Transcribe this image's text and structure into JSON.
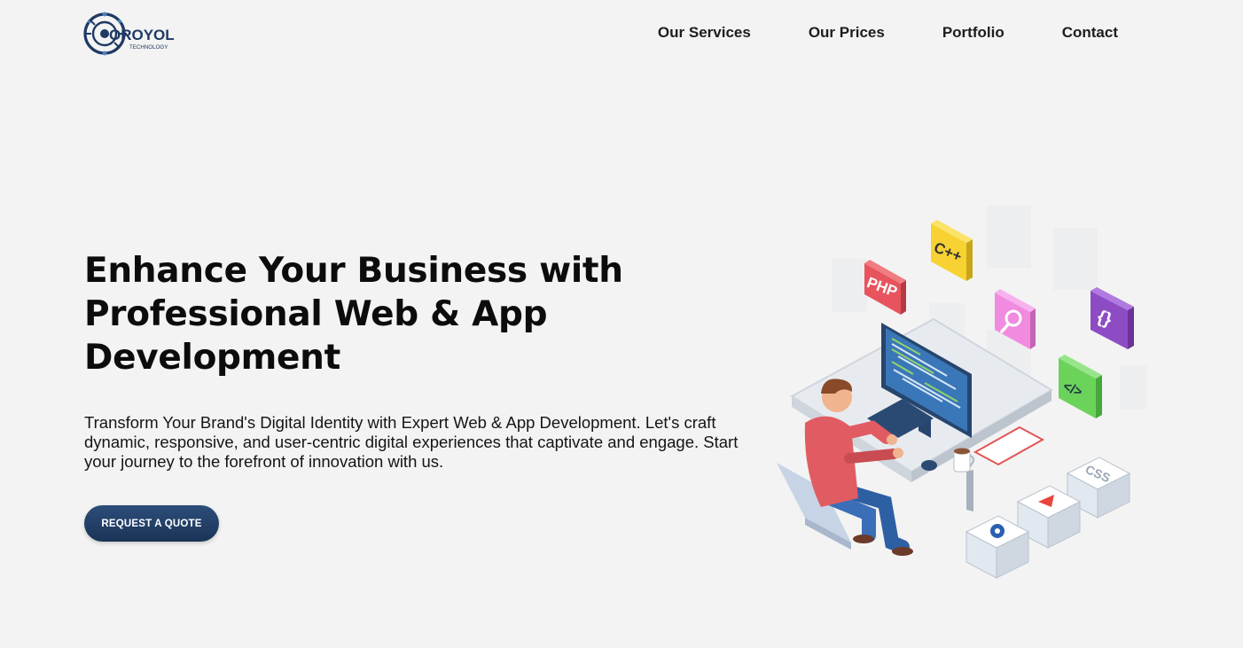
{
  "brand": {
    "name": "OROYOL",
    "tagline": "TECHNOLOGY",
    "color": "#1f3a63"
  },
  "nav": {
    "items": [
      "Our Services",
      "Our Prices",
      "Portfolio",
      "Contact"
    ]
  },
  "hero": {
    "title_line1": "Enhance Your Business with",
    "title_line2": "Professional Web & App",
    "title_line3": "Development",
    "subtitle": "Transform Your Brand's Digital Identity with Expert Web & App Development. Let's craft dynamic, responsive, and user-centric digital experiences that captivate and engage. Start your journey to the forefront of innovation with us.",
    "cta_label": "REQUEST A QUOTE",
    "cta_color": "#1f3a63"
  },
  "illustration": {
    "icon_labels": {
      "php": "PHP",
      "cpp": "C++",
      "css": "CSS",
      "braces": "{}",
      "code": "</>"
    }
  }
}
